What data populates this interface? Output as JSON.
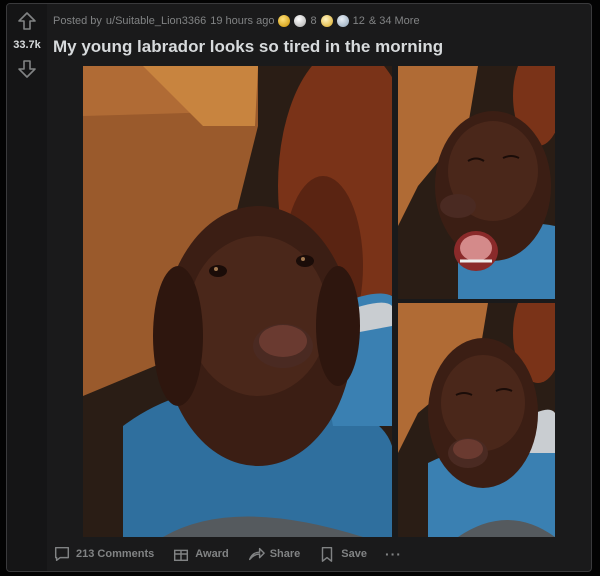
{
  "post": {
    "score": "33.7k",
    "posted_by_prefix": "Posted by",
    "username": "u/Suitable_Lion3366",
    "time_ago": "19 hours ago",
    "awards": [
      {
        "icon": "silver-award-icon",
        "count": "8"
      },
      {
        "icon": "wholesome-award-icon",
        "count": ""
      },
      {
        "icon": "helpful-award-icon",
        "count": "12"
      }
    ],
    "awards_more": "& 34 More",
    "title": "My young labrador looks so tired in the morning"
  },
  "gallery": {
    "images": [
      {
        "name": "labrador-photo-large"
      },
      {
        "name": "labrador-photo-yawning"
      },
      {
        "name": "labrador-photo-sleepy"
      }
    ]
  },
  "actions": {
    "comments": "213 Comments",
    "award": "Award",
    "share": "Share",
    "save": "Save",
    "more": "···"
  },
  "colors": {
    "background": "#030303",
    "card": "#1a1a1b",
    "text": "#d7dadc",
    "muted": "#818384"
  }
}
